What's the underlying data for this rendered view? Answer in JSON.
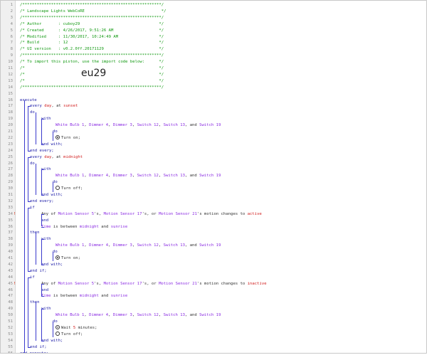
{
  "lines": [
    {
      "n": "1",
      "indent": 0,
      "parts": [
        {
          "t": "c",
          "v": "/**********************************************************/"
        }
      ]
    },
    {
      "n": "2",
      "indent": 0,
      "parts": [
        {
          "t": "c",
          "v": "/* Landscape Lights WebCoRE                                */"
        }
      ]
    },
    {
      "n": "3",
      "indent": 0,
      "parts": [
        {
          "t": "c",
          "v": "/**********************************************************/"
        }
      ]
    },
    {
      "n": "4",
      "indent": 0,
      "parts": [
        {
          "t": "c",
          "v": "/* Author       : cuboy29                                 */"
        }
      ]
    },
    {
      "n": "5",
      "indent": 0,
      "parts": [
        {
          "t": "c",
          "v": "/* Created      : 4/26/2017, 9:51:26 AM                   */"
        }
      ]
    },
    {
      "n": "6",
      "indent": 0,
      "parts": [
        {
          "t": "c",
          "v": "/* Modified     : 11/30/2017, 10:24:49 AM                 */"
        }
      ]
    },
    {
      "n": "7",
      "indent": 0,
      "parts": [
        {
          "t": "c",
          "v": "/* Build        : 12                                      */"
        }
      ]
    },
    {
      "n": "8",
      "indent": 0,
      "parts": [
        {
          "t": "c",
          "v": "/* UI version   : v0.2.0ff.20171129                       */"
        }
      ]
    },
    {
      "n": "9",
      "indent": 0,
      "parts": [
        {
          "t": "c",
          "v": "/**********************************************************/"
        }
      ]
    },
    {
      "n": "10",
      "indent": 0,
      "parts": [
        {
          "t": "c",
          "v": "/* To import this piston, use the import code below:      */"
        }
      ]
    },
    {
      "n": "11",
      "indent": 0,
      "parts": [
        {
          "t": "c",
          "v": "/*                                                        */"
        }
      ]
    },
    {
      "n": "12",
      "indent": 0,
      "parts": [
        {
          "t": "c",
          "v": "/*                                                        */"
        }
      ]
    },
    {
      "n": "13",
      "indent": 0,
      "parts": [
        {
          "t": "c",
          "v": "/*                                                        */"
        }
      ]
    },
    {
      "n": "14",
      "indent": 0,
      "parts": [
        {
          "t": "c",
          "v": "/**********************************************************/"
        }
      ]
    },
    {
      "n": "15",
      "indent": 0,
      "parts": []
    },
    {
      "n": "16",
      "indent": 0,
      "parts": [
        {
          "t": "kw",
          "v": "execute"
        }
      ]
    },
    {
      "n": "17",
      "indent": 2,
      "parts": [
        {
          "t": "kw",
          "v": "every "
        },
        {
          "t": "val",
          "v": "day"
        },
        {
          "t": "txt",
          "v": ", at "
        },
        {
          "t": "val",
          "v": "sunset"
        }
      ]
    },
    {
      "n": "18",
      "indent": 2,
      "parts": [
        {
          "t": "kw",
          "v": "do"
        }
      ]
    },
    {
      "n": "19",
      "indent": 4,
      "parts": [
        {
          "t": "kw",
          "v": "with"
        }
      ]
    },
    {
      "n": "20",
      "indent": 6,
      "parts": [
        {
          "t": "dev",
          "v": "White Bulb 1"
        },
        {
          "t": "txt",
          "v": ", "
        },
        {
          "t": "dev",
          "v": "Dimmer 4"
        },
        {
          "t": "txt",
          "v": ", "
        },
        {
          "t": "dev",
          "v": "Dimmer 3"
        },
        {
          "t": "txt",
          "v": ", "
        },
        {
          "t": "dev",
          "v": "Switch 12"
        },
        {
          "t": "txt",
          "v": ", "
        },
        {
          "t": "dev",
          "v": "Switch 13"
        },
        {
          "t": "txt",
          "v": ", and "
        },
        {
          "t": "dev",
          "v": "Switch 19"
        }
      ]
    },
    {
      "n": "21",
      "indent": 5,
      "parts": [
        {
          "t": "kw",
          "v": "do"
        }
      ]
    },
    {
      "n": "22",
      "indent": 6,
      "parts": [
        {
          "t": "icon-on",
          "v": ""
        },
        {
          "t": "txt",
          "v": "Turn on;"
        }
      ]
    },
    {
      "n": "23",
      "indent": 4,
      "parts": [
        {
          "t": "kw",
          "v": "end with;"
        }
      ]
    },
    {
      "n": "24",
      "indent": 2,
      "parts": [
        {
          "t": "kw",
          "v": "end every;"
        }
      ]
    },
    {
      "n": "25",
      "indent": 2,
      "parts": [
        {
          "t": "kw",
          "v": "every "
        },
        {
          "t": "val",
          "v": "day"
        },
        {
          "t": "txt",
          "v": ", at "
        },
        {
          "t": "val",
          "v": "midnight"
        }
      ]
    },
    {
      "n": "26",
      "indent": 2,
      "parts": [
        {
          "t": "kw",
          "v": "do"
        }
      ]
    },
    {
      "n": "27",
      "indent": 4,
      "parts": [
        {
          "t": "kw",
          "v": "with"
        }
      ]
    },
    {
      "n": "28",
      "indent": 6,
      "parts": [
        {
          "t": "dev",
          "v": "White Bulb 1"
        },
        {
          "t": "txt",
          "v": ", "
        },
        {
          "t": "dev",
          "v": "Dimmer 4"
        },
        {
          "t": "txt",
          "v": ", "
        },
        {
          "t": "dev",
          "v": "Dimmer 3"
        },
        {
          "t": "txt",
          "v": ", "
        },
        {
          "t": "dev",
          "v": "Switch 12"
        },
        {
          "t": "txt",
          "v": ", "
        },
        {
          "t": "dev",
          "v": "Switch 13"
        },
        {
          "t": "txt",
          "v": ", and "
        },
        {
          "t": "dev",
          "v": "Switch 19"
        }
      ]
    },
    {
      "n": "29",
      "indent": 5,
      "parts": [
        {
          "t": "kw",
          "v": "do"
        }
      ]
    },
    {
      "n": "30",
      "indent": 6,
      "parts": [
        {
          "t": "icon-off",
          "v": ""
        },
        {
          "t": "txt",
          "v": "Turn off;"
        }
      ]
    },
    {
      "n": "31",
      "indent": 4,
      "parts": [
        {
          "t": "kw",
          "v": "end with;"
        }
      ]
    },
    {
      "n": "32",
      "indent": 2,
      "parts": [
        {
          "t": "kw",
          "v": "end every;"
        }
      ]
    },
    {
      "n": "33",
      "indent": 2,
      "parts": [
        {
          "t": "kw",
          "v": "if"
        }
      ]
    },
    {
      "n": "34",
      "indent": 4,
      "warn": "!",
      "parts": [
        {
          "t": "txt",
          "v": "Any of "
        },
        {
          "t": "dev",
          "v": "Motion Sensor 5"
        },
        {
          "t": "txt",
          "v": "'s, "
        },
        {
          "t": "dev",
          "v": "Motion Sensor 17"
        },
        {
          "t": "txt",
          "v": "'s, or "
        },
        {
          "t": "dev",
          "v": "Motion Sensor 21"
        },
        {
          "t": "txt",
          "v": "'s motion changes to "
        },
        {
          "t": "val",
          "v": "active"
        }
      ]
    },
    {
      "n": "35",
      "indent": 4,
      "parts": [
        {
          "t": "kw",
          "v": "and"
        }
      ]
    },
    {
      "n": "36",
      "indent": 4,
      "parts": [
        {
          "t": "dev",
          "v": "Time"
        },
        {
          "t": "txt",
          "v": " is between "
        },
        {
          "t": "dev",
          "v": "midnight"
        },
        {
          "t": "txt",
          "v": " and "
        },
        {
          "t": "dev",
          "v": "sunrise"
        }
      ]
    },
    {
      "n": "37",
      "indent": 2,
      "parts": [
        {
          "t": "kw",
          "v": "then"
        }
      ]
    },
    {
      "n": "38",
      "indent": 4,
      "parts": [
        {
          "t": "kw",
          "v": "with"
        }
      ]
    },
    {
      "n": "39",
      "indent": 6,
      "parts": [
        {
          "t": "dev",
          "v": "White Bulb 1"
        },
        {
          "t": "txt",
          "v": ", "
        },
        {
          "t": "dev",
          "v": "Dimmer 4"
        },
        {
          "t": "txt",
          "v": ", "
        },
        {
          "t": "dev",
          "v": "Dimmer 3"
        },
        {
          "t": "txt",
          "v": ", "
        },
        {
          "t": "dev",
          "v": "Switch 12"
        },
        {
          "t": "txt",
          "v": ", "
        },
        {
          "t": "dev",
          "v": "Switch 13"
        },
        {
          "t": "txt",
          "v": ", and "
        },
        {
          "t": "dev",
          "v": "Switch 19"
        }
      ]
    },
    {
      "n": "40",
      "indent": 5,
      "parts": [
        {
          "t": "kw",
          "v": "do"
        }
      ]
    },
    {
      "n": "41",
      "indent": 6,
      "parts": [
        {
          "t": "icon-on",
          "v": ""
        },
        {
          "t": "txt",
          "v": "Turn on;"
        }
      ]
    },
    {
      "n": "42",
      "indent": 4,
      "parts": [
        {
          "t": "kw",
          "v": "end with;"
        }
      ]
    },
    {
      "n": "43",
      "indent": 2,
      "parts": [
        {
          "t": "kw",
          "v": "end if;"
        }
      ]
    },
    {
      "n": "44",
      "indent": 2,
      "parts": [
        {
          "t": "kw",
          "v": "if"
        }
      ]
    },
    {
      "n": "45",
      "indent": 4,
      "warn": "!",
      "parts": [
        {
          "t": "txt",
          "v": "Any of "
        },
        {
          "t": "dev",
          "v": "Motion Sensor 5"
        },
        {
          "t": "txt",
          "v": "'s, "
        },
        {
          "t": "dev",
          "v": "Motion Sensor 17"
        },
        {
          "t": "txt",
          "v": "'s, or "
        },
        {
          "t": "dev",
          "v": "Motion Sensor 21"
        },
        {
          "t": "txt",
          "v": "'s motion changes to "
        },
        {
          "t": "val",
          "v": "inactive"
        }
      ]
    },
    {
      "n": "46",
      "indent": 4,
      "parts": [
        {
          "t": "kw",
          "v": "and"
        }
      ]
    },
    {
      "n": "47",
      "indent": 4,
      "parts": [
        {
          "t": "dev",
          "v": "Time"
        },
        {
          "t": "txt",
          "v": " is between "
        },
        {
          "t": "dev",
          "v": "midnight"
        },
        {
          "t": "txt",
          "v": " and "
        },
        {
          "t": "dev",
          "v": "sunrise"
        }
      ]
    },
    {
      "n": "48",
      "indent": 2,
      "parts": [
        {
          "t": "kw",
          "v": "then"
        }
      ]
    },
    {
      "n": "49",
      "indent": 4,
      "parts": [
        {
          "t": "kw",
          "v": "with"
        }
      ]
    },
    {
      "n": "50",
      "indent": 6,
      "parts": [
        {
          "t": "dev",
          "v": "White Bulb 1"
        },
        {
          "t": "txt",
          "v": ", "
        },
        {
          "t": "dev",
          "v": "Dimmer 4"
        },
        {
          "t": "txt",
          "v": ", "
        },
        {
          "t": "dev",
          "v": "Dimmer 3"
        },
        {
          "t": "txt",
          "v": ", "
        },
        {
          "t": "dev",
          "v": "Switch 12"
        },
        {
          "t": "txt",
          "v": ", "
        },
        {
          "t": "dev",
          "v": "Switch 13"
        },
        {
          "t": "txt",
          "v": ", and "
        },
        {
          "t": "dev",
          "v": "Switch 19"
        }
      ]
    },
    {
      "n": "51",
      "indent": 5,
      "parts": [
        {
          "t": "kw",
          "v": "do"
        }
      ]
    },
    {
      "n": "52",
      "indent": 6,
      "parts": [
        {
          "t": "icon-clock",
          "v": ""
        },
        {
          "t": "txt",
          "v": "Wait "
        },
        {
          "t": "val",
          "v": "5"
        },
        {
          "t": "txt",
          "v": " minutes;"
        }
      ]
    },
    {
      "n": "53",
      "indent": 6,
      "parts": [
        {
          "t": "icon-off",
          "v": ""
        },
        {
          "t": "txt",
          "v": "Turn off;"
        }
      ]
    },
    {
      "n": "54",
      "indent": 4,
      "parts": [
        {
          "t": "kw",
          "v": "end with;"
        }
      ]
    },
    {
      "n": "55",
      "indent": 2,
      "parts": [
        {
          "t": "kw",
          "v": "end if;"
        }
      ]
    },
    {
      "n": "56",
      "indent": 0,
      "parts": [
        {
          "t": "kw",
          "v": "end execute;"
        }
      ]
    }
  ],
  "import_code": "eu29",
  "colors": {
    "comment": "#119911",
    "keyword": "#1a1aa6",
    "device": "#8a2be2",
    "value": "#d11b1b",
    "bracket": "#3a3acc"
  }
}
